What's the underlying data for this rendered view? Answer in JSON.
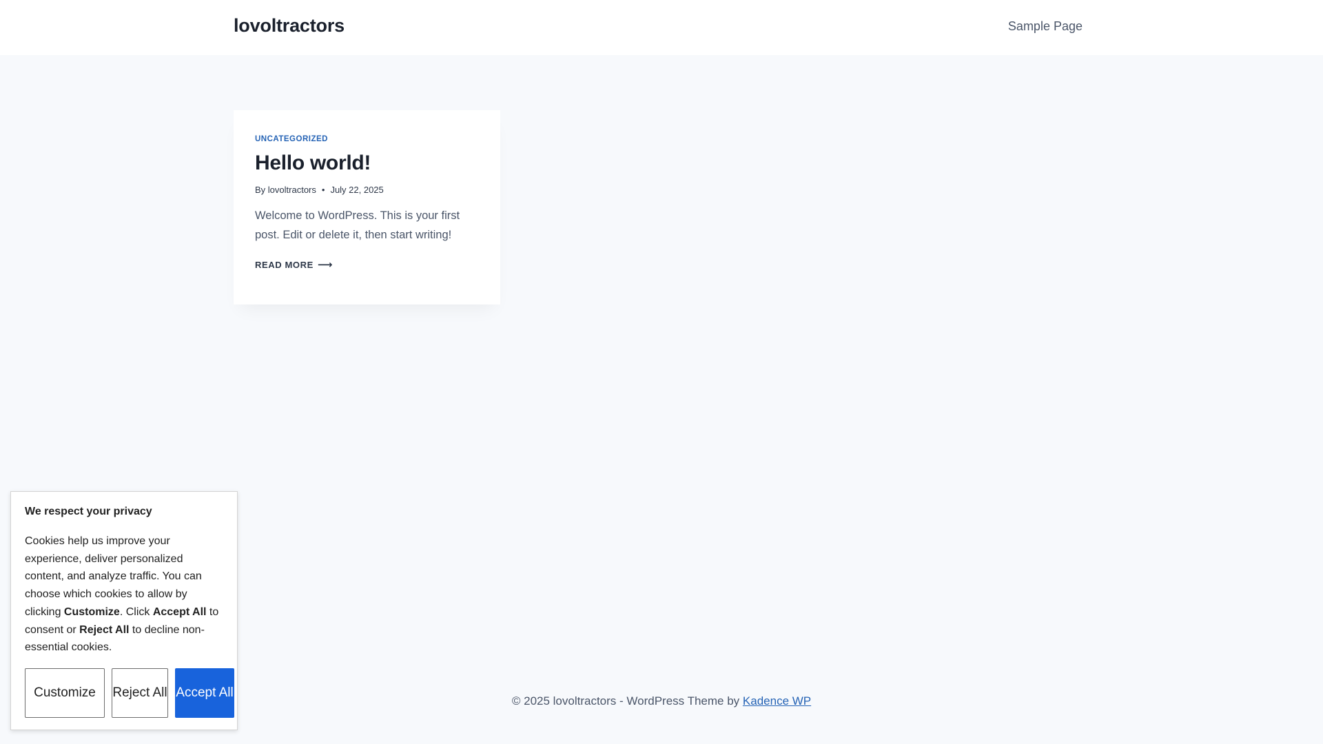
{
  "header": {
    "site_title": "lovoltractors",
    "nav": [
      {
        "label": "Sample Page"
      }
    ]
  },
  "post": {
    "category": "UNCATEGORIZED",
    "title": "Hello world!",
    "by_label": "By",
    "author": "lovoltractors",
    "date": "July 22, 2025",
    "excerpt": "Welcome to WordPress. This is your first post. Edit or delete it, then start writing!",
    "read_more": "READ MORE",
    "read_more_icon": "arrow-right-icon"
  },
  "footer": {
    "text": "© 2025 lovoltractors - WordPress Theme by",
    "link": "Kadence WP"
  },
  "cookie_banner": {
    "title": "We respect your privacy",
    "body_parts": [
      "Cookies help us improve your experience, deliver personalized content, and analyze traffic. You can choose which cookies to allow by clicking ",
      "Customize",
      ". Click ",
      "Accept All",
      " to consent or ",
      "Reject All",
      " to decline non-essential cookies."
    ],
    "buttons": {
      "customize": "Customize",
      "reject": "Reject All",
      "accept": "Accept All"
    },
    "accent_color": "#1863dc"
  }
}
